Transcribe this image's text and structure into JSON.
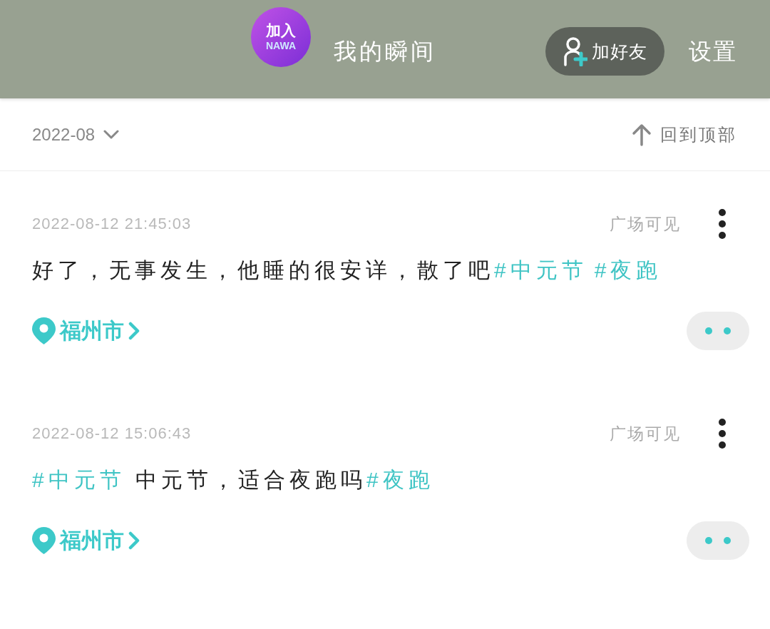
{
  "header": {
    "avatar": {
      "line_1": "加入",
      "line_2": "NAWA"
    },
    "title": "我的瞬间",
    "add_friend_button": "加好友",
    "settings_link": "设置"
  },
  "month_bar": {
    "month": "2022-08",
    "back_to_top": "回到顶部"
  },
  "posts": [
    {
      "timestamp": "2022-08-12 21:45:03",
      "visibility": "广场可见",
      "segments": [
        {
          "kind": "text",
          "text": "好了，无事发生，他睡的很安详，散了吧"
        },
        {
          "kind": "tag",
          "text": "#中元节"
        },
        {
          "kind": "tag",
          "text": "#夜跑"
        }
      ],
      "location": "福州市"
    },
    {
      "timestamp": "2022-08-12 15:06:43",
      "visibility": "广场可见",
      "segments": [
        {
          "kind": "tag",
          "text": "#中元节"
        },
        {
          "kind": "text",
          "text": " 中元节，适合夜跑吗"
        },
        {
          "kind": "tag",
          "text": "#夜跑"
        }
      ],
      "location": "福州市"
    }
  ]
}
